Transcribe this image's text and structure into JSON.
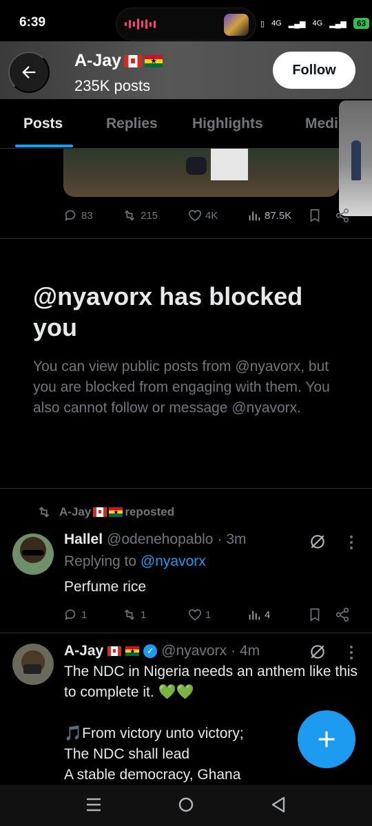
{
  "status_bar": {
    "time": "6:39",
    "network_1": "4G",
    "network_2": "4G",
    "battery": "63"
  },
  "header": {
    "name": "A-Jay",
    "posts_count": "235K posts",
    "follow_label": "Follow"
  },
  "tabs": [
    {
      "label": "Posts",
      "active": true
    },
    {
      "label": "Replies",
      "active": false
    },
    {
      "label": "Highlights",
      "active": false
    },
    {
      "label": "Medi",
      "active": false
    }
  ],
  "top_post_actions": {
    "replies": "83",
    "reposts": "215",
    "likes": "4K",
    "views": "87.5K"
  },
  "blocked_notice": {
    "title": "@nyavorx has blocked you",
    "body": "You can view public posts from @nyavorx, but you are blocked from engaging with them. You also cannot follow or message @nyavorx."
  },
  "repost_tweet": {
    "repost_by": "A-Jay",
    "repost_label": "reposted",
    "name": "Hallel",
    "handle": "@odenehopablo",
    "time": "· 3m",
    "replying_to_label": "Replying to",
    "replying_to": "@nyavorx",
    "text": "Perfume rice",
    "actions": {
      "replies": "1",
      "reposts": "1",
      "likes": "1",
      "views": "4"
    }
  },
  "main_tweet": {
    "name": "A-Jay",
    "handle": "@nyavorx",
    "time": "· 4m",
    "text": "The NDC in Nigeria needs an anthem like this to complete it. 💚💚\n\n🎵From victory unto victory;\nThe NDC shall lead\nA stable democracy, Ghana"
  },
  "colors": {
    "accent": "#1d9bf0",
    "background": "#000000",
    "muted_text": "#71767b",
    "divider": "#2f3336"
  },
  "icons": [
    "back-arrow-icon",
    "reply-icon",
    "repost-icon",
    "like-icon",
    "views-icon",
    "bookmark-icon",
    "share-icon",
    "grok-icon",
    "more-icon",
    "verified-icon",
    "plus-icon",
    "recent-apps-icon",
    "home-icon",
    "back-icon"
  ]
}
